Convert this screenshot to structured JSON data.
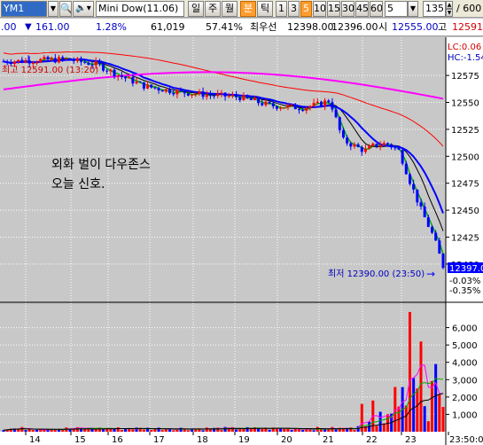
{
  "toolbar": {
    "symbol": "YM1",
    "instrument_name": "Mini Dow(11.06)",
    "period_buttons": [
      "일",
      "주",
      "월"
    ],
    "active_buttons": [
      "분",
      "틱"
    ],
    "interval_buttons": [
      "1",
      "3",
      "5",
      "10",
      "15",
      "30",
      "45",
      "60"
    ],
    "selected_interval": "5",
    "interval_select": "5",
    "count_value": "135",
    "count_total": "/ 600"
  },
  "infobar": {
    "change_prefix": ".00",
    "change_value": "161.00",
    "change_pct": "1.28%",
    "volume": "61,019",
    "volume_ratio": "57.41%",
    "bid_label": "최우선",
    "bid_price": "12398.00",
    "ask_price": "12396.00",
    "open_label": "시",
    "open_price": "12555.00",
    "high_label": "고",
    "high_price": "12591."
  },
  "chart_data": {
    "type": "candlestick",
    "x_ticks": [
      "14",
      "15",
      "16",
      "17",
      "18",
      "19",
      "20",
      "21",
      "22",
      "23",
      "23:50:00"
    ],
    "y_ticks": [
      12575,
      12550,
      12525,
      12500,
      12475,
      12450,
      12425,
      12400
    ],
    "ylim": [
      12367,
      12608
    ],
    "pct_ticks": [
      "-0.03%",
      "-0.35%"
    ],
    "last_price": "12397.0",
    "legend_lc": "LC:0.06",
    "legend_hc": "HC:-1.54",
    "high_annotation": "최고 12591.00 (13:20)",
    "low_annotation": "최저 12390.00 (23:50)",
    "note_line1": "외화 벌이 다우존스",
    "note_line2": "오늘 신호.",
    "volume_ticks": [
      "6,000",
      "5,000",
      "4,000",
      "3,000",
      "2,000",
      "1,000"
    ],
    "volume_ylim": [
      0,
      7000
    ],
    "ma_colors": {
      "ma_short": "#00aa00",
      "ma_mid": "#0000ff",
      "ma_long": "#ff0000",
      "ma_longest": "#ff00ff",
      "ma_black": "#000000"
    },
    "candle_up": "#ff0000",
    "candle_down": "#0000ff"
  }
}
